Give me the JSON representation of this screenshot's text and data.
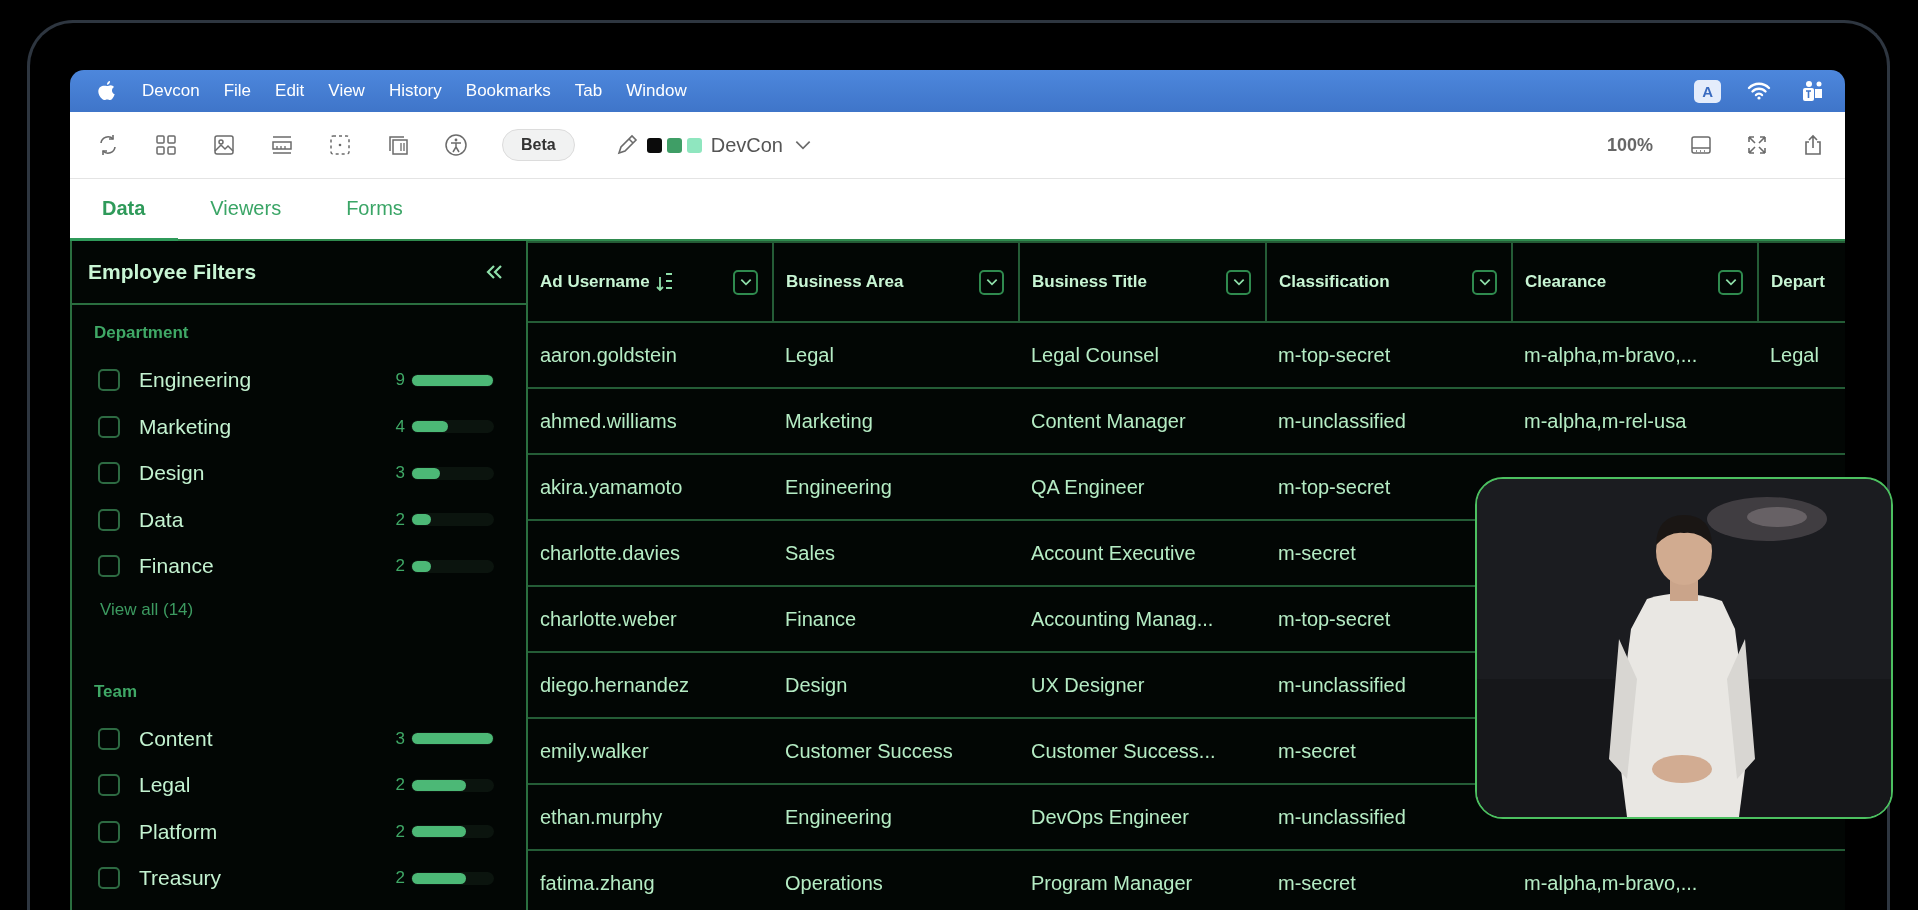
{
  "menu_bar": {
    "items": [
      "Devcon",
      "File",
      "Edit",
      "View",
      "History",
      "Bookmarks",
      "Tab",
      "Window"
    ],
    "input_indicator": "A"
  },
  "toolbar": {
    "beta_label": "Beta",
    "swatches": [
      {
        "color": "#0b0b0b"
      },
      {
        "color": "#3f9e66"
      },
      {
        "color": "#8fe6bf"
      }
    ],
    "workspace": "DevCon",
    "zoom": "100%"
  },
  "tabs": [
    {
      "label": "Data",
      "selected": true
    },
    {
      "label": "Viewers",
      "selected": false
    },
    {
      "label": "Forms",
      "selected": false
    }
  ],
  "sidebar": {
    "title": "Employee Filters",
    "groups": [
      {
        "title": "Department",
        "view_all": "View all (14)",
        "items": [
          {
            "label": "Engineering",
            "count": "9",
            "checked": false,
            "level": 1
          },
          {
            "label": "Marketing",
            "count": "4",
            "checked": false,
            "level": 0.45
          },
          {
            "label": "Design",
            "count": "3",
            "checked": false,
            "level": 0.34
          },
          {
            "label": "Data",
            "count": "2",
            "checked": false,
            "level": 0.23
          },
          {
            "label": "Finance",
            "count": "2",
            "checked": false,
            "level": 0.23
          }
        ]
      },
      {
        "title": "Team",
        "items": [
          {
            "label": "Content",
            "count": "3",
            "checked": false,
            "level": 1
          },
          {
            "label": "Legal",
            "count": "2",
            "checked": false,
            "level": 0.67
          },
          {
            "label": "Platform",
            "count": "2",
            "checked": false,
            "level": 0.67
          },
          {
            "label": "Treasury",
            "count": "2",
            "checked": false,
            "level": 0.67
          }
        ]
      }
    ]
  },
  "table": {
    "columns": [
      {
        "label": "Ad Username",
        "sorted": true
      },
      {
        "label": "Business Area",
        "sorted": false
      },
      {
        "label": "Business Title",
        "sorted": false
      },
      {
        "label": "Classification",
        "sorted": false
      },
      {
        "label": "Clearance",
        "sorted": false
      },
      {
        "label": "Depart",
        "sorted": false
      }
    ],
    "rows": [
      [
        "aaron.goldstein",
        "Legal",
        "Legal Counsel",
        "m-top-secret",
        "m-alpha,m-bravo,...",
        "Legal"
      ],
      [
        "ahmed.williams",
        "Marketing",
        "Content Manager",
        "m-unclassified",
        "m-alpha,m-rel-usa",
        null
      ],
      [
        "akira.yamamoto",
        "Engineering",
        "QA Engineer",
        "m-top-secret",
        null,
        null
      ],
      [
        "charlotte.davies",
        "Sales",
        "Account Executive",
        "m-secret",
        null,
        null
      ],
      [
        "charlotte.weber",
        "Finance",
        "Accounting Manag...",
        "m-top-secret",
        null,
        null
      ],
      [
        "diego.hernandez",
        "Design",
        "UX Designer",
        "m-unclassified",
        null,
        null
      ],
      [
        "emily.walker",
        "Customer Success",
        "Customer Success...",
        "m-secret",
        null,
        null
      ],
      [
        "ethan.murphy",
        "Engineering",
        "DevOps Engineer",
        "m-unclassified",
        null,
        null
      ],
      [
        "fatima.zhang",
        "Operations",
        "Program Manager",
        "m-secret",
        "m-alpha,m-bravo,...",
        null
      ]
    ]
  }
}
